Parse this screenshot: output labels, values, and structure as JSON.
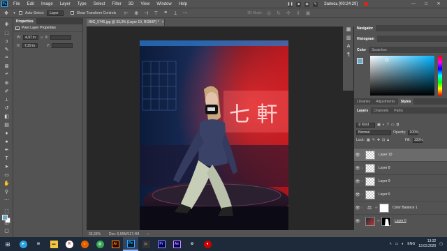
{
  "menubar": {
    "logo": "Ps",
    "items": [
      "File",
      "Edit",
      "Image",
      "Layer",
      "Type",
      "Select",
      "Filter",
      "3D",
      "View",
      "Window",
      "Help"
    ]
  },
  "recorder": {
    "label": "Запись [00:24:29]",
    "buttons": [
      "pause-icon",
      "stop-icon",
      "camera-icon",
      "pencil-icon"
    ]
  },
  "window_controls": [
    "—",
    "□",
    "✕"
  ],
  "options_bar": {
    "tool_icon": "move-icon",
    "auto_select_label": "Auto-Select:",
    "auto_select_value": "Layer",
    "transform_label": "Show Transform Controls",
    "mode_label": "3D Mode:"
  },
  "properties": {
    "tab": "Properties",
    "header": "Pixel Layer Properties",
    "w_label": "W:",
    "w_value": "4,97 in",
    "x_label": "X:",
    "h_label": "H:",
    "h_value": "7,29 in",
    "y_label": "Y:"
  },
  "document": {
    "tab_title": "IMG_5745.jpg @ 33,3% (Layer 10, RGB/8*) *",
    "close": "×",
    "zoom": "33,33%",
    "doc_info": "Doc: 6,66M/117,4M"
  },
  "canvas_sign": "七 軒",
  "right_top": {
    "navigator": "Navigator",
    "histogram": "Histogram"
  },
  "color_panel": {
    "tabs": [
      "Color",
      "Swatches"
    ],
    "fg_color": "#6ea8c7",
    "bg_color": "#ffffff"
  },
  "layers_panel": {
    "top_tabs": [
      "Libraries",
      "Adjustments",
      "Styles"
    ],
    "tabs": [
      "Layers",
      "Channels",
      "Paths"
    ],
    "filter_kind": "Kind",
    "blend_mode": "Normal",
    "opacity_label": "Opacity:",
    "opacity_value": "100%",
    "lock_label": "Lock:",
    "fill_label": "Fill:",
    "fill_value": "100%",
    "layers": [
      {
        "name": "Layer 10",
        "thumb": "checker",
        "selected": true
      },
      {
        "name": "Layer 8",
        "thumb": "checker",
        "selected": false
      },
      {
        "name": "Layer 9",
        "thumb": "checker",
        "selected": false
      },
      {
        "name": "Layer 6",
        "thumb": "checker",
        "selected": false
      },
      {
        "name": "Color Balance 1",
        "thumb": "white",
        "selected": false
      },
      {
        "name": "Layer 0",
        "thumb": "photo",
        "selected": false
      }
    ]
  },
  "taskbar": {
    "time": "13:32",
    "date": "13.03.2020",
    "lang": "ENG",
    "apps": [
      "Ai",
      "Ps",
      "Pr",
      "Ae"
    ]
  }
}
